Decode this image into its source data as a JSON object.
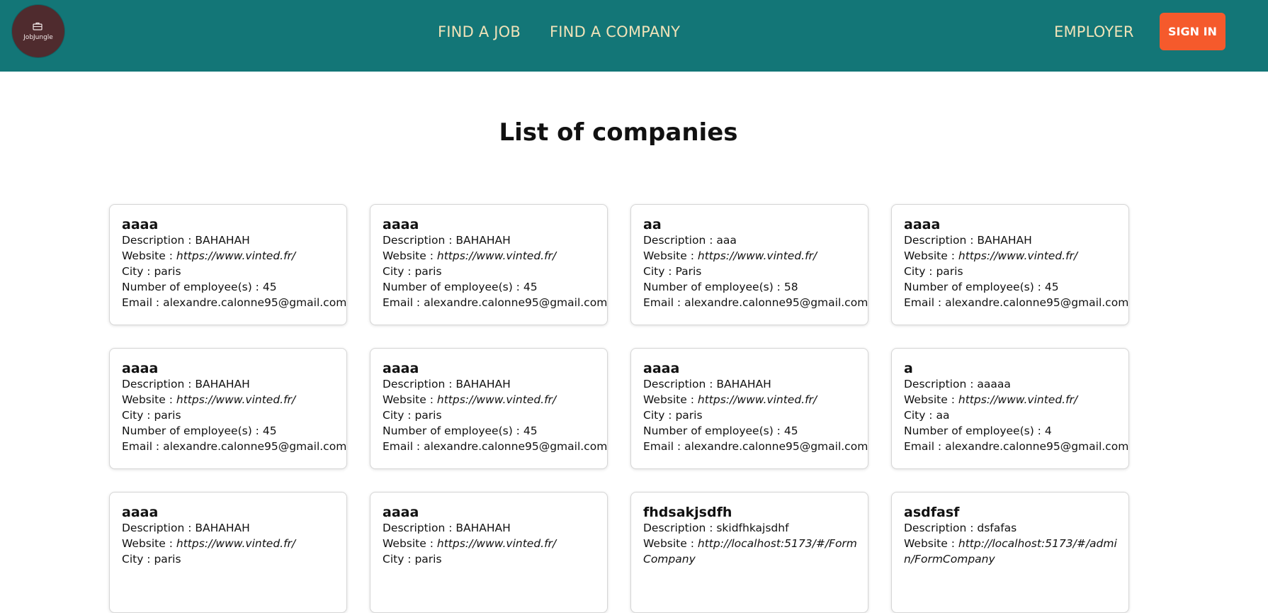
{
  "header": {
    "logo_text": "JobJungle",
    "logo_icon": "briefcase-icon",
    "nav": {
      "find_job": "FIND A JOB",
      "find_company": "FIND A COMPANY",
      "employer": "EMPLOYER"
    },
    "sign_in": "SIGN IN",
    "colors": {
      "navbar_bg": "#137677",
      "nav_text": "#f0e2b8",
      "sign_in_bg": "#f55a2c",
      "logo_bg": "#4f2b2e"
    }
  },
  "main": {
    "title": "List of companies",
    "labels": {
      "description": "Description : ",
      "website": "Website : ",
      "city": "City : ",
      "employees": "Number of employee(s) : ",
      "email": "Email : "
    },
    "companies": [
      {
        "name": "aaaa",
        "description": "BAHAHAH",
        "website": "https://www.vinted.fr/",
        "city": "paris",
        "employees": "45",
        "email": "alexandre.calonne95@gmail.com"
      },
      {
        "name": "aaaa",
        "description": "BAHAHAH",
        "website": "https://www.vinted.fr/",
        "city": "paris",
        "employees": "45",
        "email": "alexandre.calonne95@gmail.com"
      },
      {
        "name": "aa",
        "description": "aaa",
        "website": "https://www.vinted.fr/",
        "city": "Paris",
        "employees": "58",
        "email": "alexandre.calonne95@gmail.com"
      },
      {
        "name": "aaaa",
        "description": "BAHAHAH",
        "website": "https://www.vinted.fr/",
        "city": "paris",
        "employees": "45",
        "email": "alexandre.calonne95@gmail.com"
      },
      {
        "name": "aaaa",
        "description": "BAHAHAH",
        "website": "https://www.vinted.fr/",
        "city": "paris",
        "employees": "45",
        "email": "alexandre.calonne95@gmail.com"
      },
      {
        "name": "aaaa",
        "description": "BAHAHAH",
        "website": "https://www.vinted.fr/",
        "city": "paris",
        "employees": "45",
        "email": "alexandre.calonne95@gmail.com"
      },
      {
        "name": "aaaa",
        "description": "BAHAHAH",
        "website": "https://www.vinted.fr/",
        "city": "paris",
        "employees": "45",
        "email": "alexandre.calonne95@gmail.com"
      },
      {
        "name": "a",
        "description": "aaaaa",
        "website": "https://www.vinted.fr/",
        "city": "aa",
        "employees": "4",
        "email": "alexandre.calonne95@gmail.com"
      },
      {
        "name": "aaaa",
        "description": "BAHAHAH",
        "website": "https://www.vinted.fr/",
        "city": "paris",
        "employees": "",
        "email": ""
      },
      {
        "name": "aaaa",
        "description": "BAHAHAH",
        "website": "https://www.vinted.fr/",
        "city": "paris",
        "employees": "",
        "email": ""
      },
      {
        "name": "fhdsakjsdfh",
        "description": "skidfhkajsdhf",
        "website": "http://localhost:5173/#/FormCompany",
        "city": "",
        "employees": "",
        "email": ""
      },
      {
        "name": "asdfasf",
        "description": "dsfafas",
        "website": "http://localhost:5173/#/admin/FormCompany",
        "city": "",
        "employees": "",
        "email": ""
      }
    ]
  }
}
